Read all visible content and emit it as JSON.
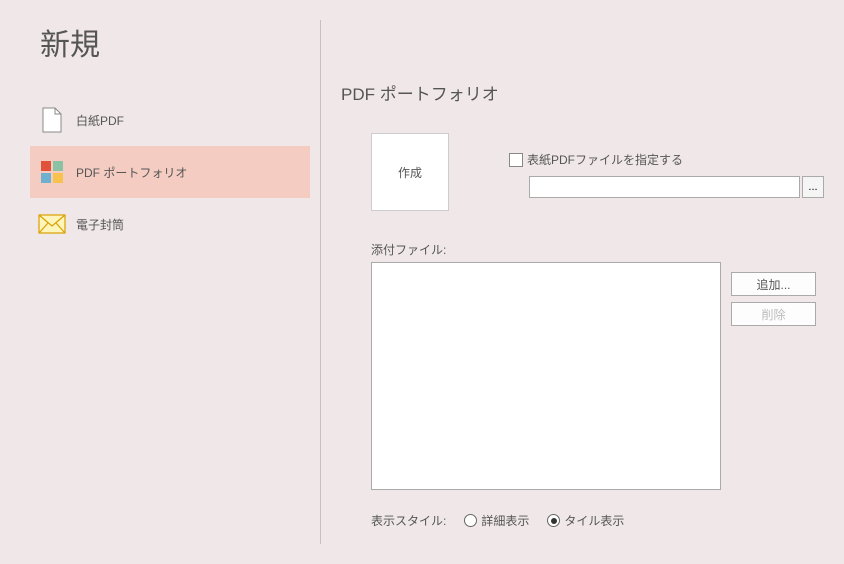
{
  "page_title": "新規",
  "sidebar": {
    "items": [
      {
        "label": "白紙PDF"
      },
      {
        "label": "PDF ポートフォリオ"
      },
      {
        "label": "電子封筒"
      }
    ]
  },
  "main": {
    "title": "PDF ポートフォリオ",
    "create_label": "作成",
    "cover_checkbox_label": "表紙PDFファイルを指定する",
    "cover_file_value": "",
    "browse_label": "...",
    "attach_label": "添付ファイル:",
    "add_button": "追加...",
    "remove_button": "削除",
    "style_label": "表示スタイル:",
    "style_options": [
      {
        "label": "詳細表示",
        "checked": false
      },
      {
        "label": "タイル表示",
        "checked": true
      }
    ]
  }
}
